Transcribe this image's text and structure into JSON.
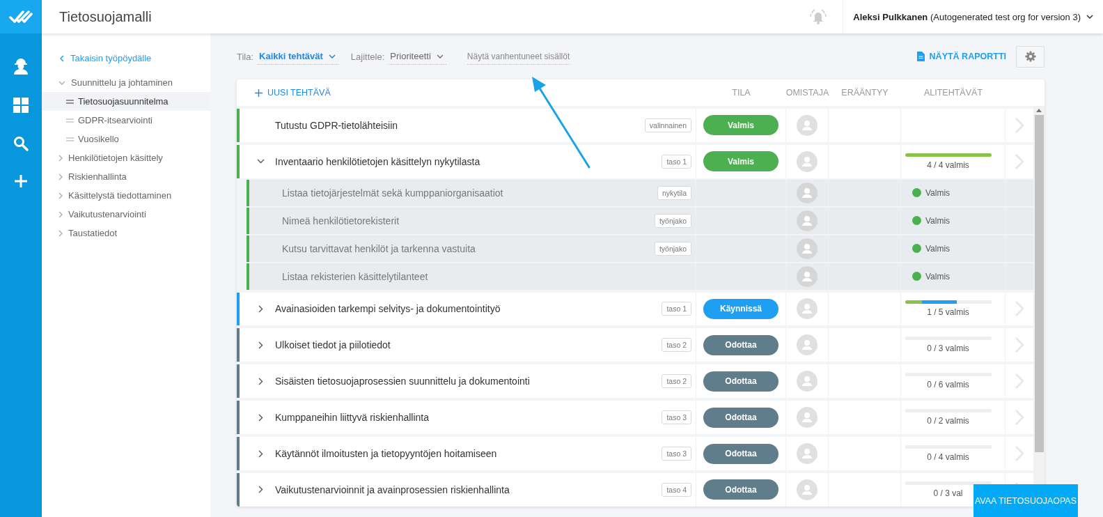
{
  "header": {
    "title": "Tietosuojamalli",
    "user_name": "Aleksi Pulkkanen",
    "org": "(Autogenerated test org for version 3)"
  },
  "sidebar": {
    "back": "Takaisin työpöydälle",
    "items": [
      {
        "label": "Suunnittelu ja johtaminen",
        "expanded": true,
        "selected": false,
        "children": [
          {
            "label": "Tietosuojasuunnitelma",
            "selected": true
          },
          {
            "label": "GDPR-itsearviointi",
            "selected": false
          },
          {
            "label": "Vuosikello",
            "selected": false
          }
        ]
      },
      {
        "label": "Henkilötietojen käsittely",
        "expanded": false,
        "selected": false
      },
      {
        "label": "Riskienhallinta",
        "expanded": false,
        "selected": false
      },
      {
        "label": "Käsittelystä tiedottaminen",
        "expanded": false,
        "selected": false
      },
      {
        "label": "Vaikutustenarviointi",
        "expanded": false,
        "selected": false
      },
      {
        "label": "Taustatiedot",
        "expanded": false,
        "selected": false
      }
    ]
  },
  "toolbar": {
    "filters": [
      {
        "label": "Tila:",
        "value": "Kaikki tehtävät",
        "highlighted": true
      },
      {
        "label": "Lajittele:",
        "value": "Prioriteetti",
        "highlighted": false
      }
    ],
    "toggle": "Näytä vanhentuneet sisällöt",
    "report": "NÄYTÄ RAPORTTI"
  },
  "table": {
    "new_task": "UUSI TEHTÄVÄ",
    "columns": [
      "TILA",
      "OMISTAJA",
      "ERÄÄNTYY",
      "ALITEHTÄVÄT"
    ],
    "rows": [
      {
        "kind": "leaf",
        "title": "Tutustu GDPR-tietolähteisiin",
        "tag": "valinnainen",
        "status": {
          "kind": "done",
          "label": "Valmis"
        }
      },
      {
        "kind": "group",
        "expanded": true,
        "title": "Inventaario henkilötietojen käsittelyn nykytilasta",
        "tag": "taso 1",
        "status": {
          "kind": "done",
          "label": "Valmis"
        },
        "progress": {
          "text": "4 / 4 valmis",
          "segments": [
            {
              "color": "#8bc34a",
              "level": 1
            }
          ]
        },
        "children": [
          {
            "title": "Listaa tietojärjestelmät sekä kumppaniorganisaatiot",
            "tag": "nykytila",
            "status": {
              "kind": "done",
              "label": "Valmis"
            }
          },
          {
            "title": "Nimeä henkilötietorekisterit",
            "tag": "työnjako",
            "status": {
              "kind": "done",
              "label": "Valmis"
            }
          },
          {
            "title": "Kutsu tarvittavat henkilöt ja tarkenna vastuita",
            "tag": "työnjako",
            "status": {
              "kind": "done",
              "label": "Valmis"
            }
          },
          {
            "title": "Listaa rekisterien käsittelytilanteet",
            "status": {
              "kind": "done",
              "label": "Valmis"
            }
          }
        ]
      },
      {
        "kind": "group",
        "expanded": false,
        "title": "Avainasioiden tarkempi selvitys- ja dokumentointityö",
        "tag": "taso 1",
        "status": {
          "kind": "running",
          "label": "Käynnissä"
        },
        "progress": {
          "text": "1 / 5 valmis",
          "segments": [
            {
              "color": "#8bc34a",
              "level": 0.2
            },
            {
              "color": "#1e9ff2",
              "level": 0.4
            }
          ]
        }
      },
      {
        "kind": "group",
        "expanded": false,
        "title": "Ulkoiset tiedot ja piilotiedot",
        "tag": "taso 2",
        "status": {
          "kind": "waiting",
          "label": "Odottaa"
        },
        "progress": {
          "text": "0 / 3 valmis"
        }
      },
      {
        "kind": "group",
        "expanded": false,
        "title": "Sisäisten tietosuojaprosessien suunnittelu ja dokumentointi",
        "tag": "taso 2",
        "status": {
          "kind": "waiting",
          "label": "Odottaa"
        },
        "progress": {
          "text": "0 / 6 valmis"
        }
      },
      {
        "kind": "group",
        "expanded": false,
        "title": "Kumppaneihin liittyvä riskienhallinta",
        "tag": "taso 3",
        "status": {
          "kind": "waiting",
          "label": "Odottaa"
        },
        "progress": {
          "text": "0 / 2 valmis"
        }
      },
      {
        "kind": "group",
        "expanded": false,
        "title": "Käytännöt ilmoitusten ja tietopyyntöjen hoitamiseen",
        "tag": "taso 3",
        "status": {
          "kind": "waiting",
          "label": "Odottaa"
        },
        "progress": {
          "text": "0 / 4 valmis"
        }
      },
      {
        "kind": "group",
        "expanded": false,
        "title": "Vaikutustenarvioinnit ja avainprosessien riskienhallinta",
        "tag": "taso 4",
        "status": {
          "kind": "waiting",
          "label": "Odottaa"
        },
        "progress": {
          "text": "0 / 3 val"
        }
      }
    ]
  },
  "guide_button": "AVAA TIETOSUOJAOPAS"
}
